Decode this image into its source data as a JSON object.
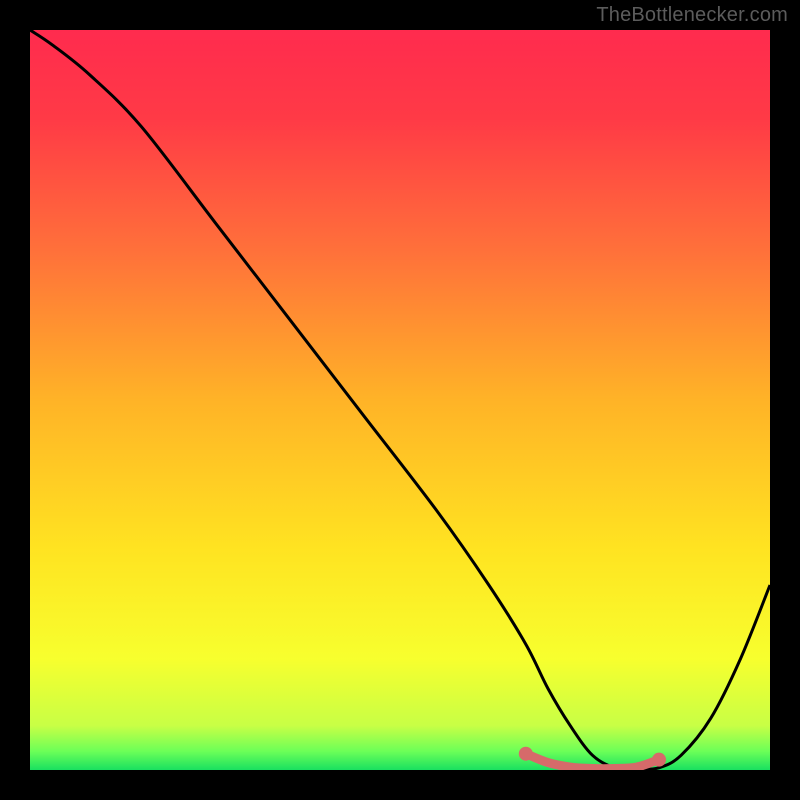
{
  "attribution": "TheBottlenecker.com",
  "chart_data": {
    "type": "line",
    "title": "",
    "xlabel": "",
    "ylabel": "",
    "xlim": [
      0,
      100
    ],
    "ylim": [
      0,
      100
    ],
    "series": [
      {
        "name": "curve",
        "color": "#000000",
        "x": [
          0,
          3,
          8,
          15,
          25,
          35,
          45,
          55,
          62,
          67,
          70,
          73,
          76,
          79,
          82,
          85,
          88,
          92,
          96,
          100
        ],
        "y": [
          100,
          98,
          94,
          87,
          74,
          61,
          48,
          35,
          25,
          17,
          11,
          6,
          2,
          0.3,
          0.1,
          0.3,
          2,
          7,
          15,
          25
        ]
      },
      {
        "name": "highlight",
        "color": "#d66a6a",
        "x": [
          67,
          70,
          73,
          76,
          79,
          82,
          85
        ],
        "y": [
          2.2,
          1,
          0.4,
          0.2,
          0.2,
          0.4,
          1.4
        ]
      }
    ],
    "gradient_stops": [
      {
        "offset": 0.0,
        "color": "#ff2b4e"
      },
      {
        "offset": 0.12,
        "color": "#ff3a46"
      },
      {
        "offset": 0.3,
        "color": "#ff713a"
      },
      {
        "offset": 0.5,
        "color": "#ffb327"
      },
      {
        "offset": 0.7,
        "color": "#ffe321"
      },
      {
        "offset": 0.85,
        "color": "#f7ff2e"
      },
      {
        "offset": 0.94,
        "color": "#c8ff45"
      },
      {
        "offset": 0.975,
        "color": "#6bff58"
      },
      {
        "offset": 1.0,
        "color": "#19e060"
      }
    ]
  }
}
